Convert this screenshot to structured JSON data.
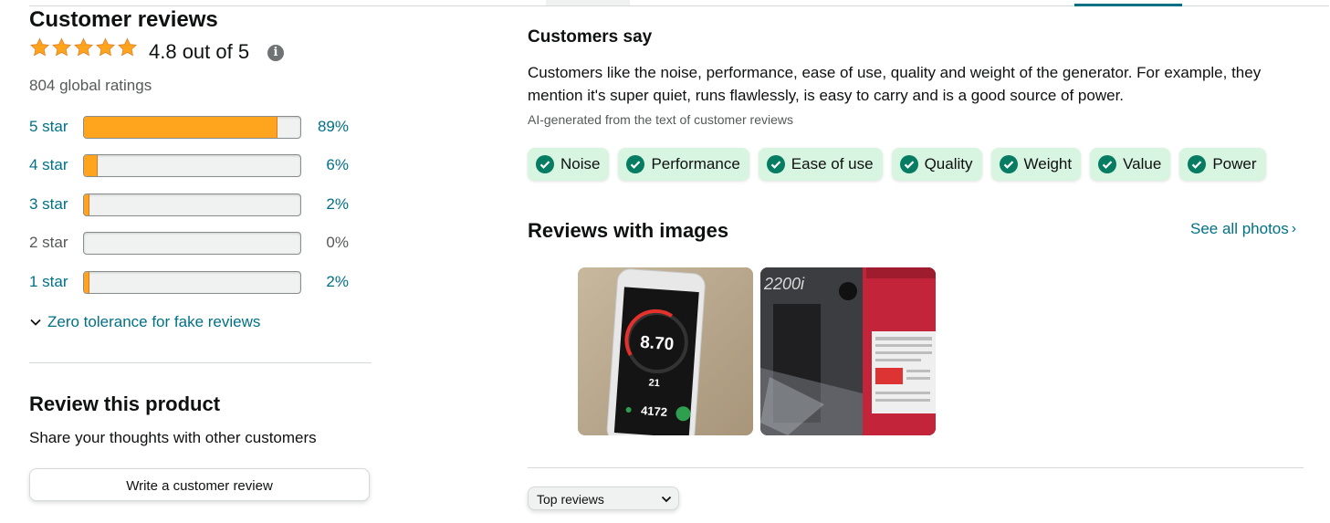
{
  "ratings": {
    "heading": "Customer reviews",
    "stars_shown": 4.8,
    "rating_text": "4.8 out of 5",
    "info_icon": "info-icon",
    "global_ratings": "804 global ratings",
    "histogram": [
      {
        "label": "5 star",
        "percent": 89,
        "percent_text": "89%"
      },
      {
        "label": "4 star",
        "percent": 6,
        "percent_text": "6%"
      },
      {
        "label": "3 star",
        "percent": 2,
        "percent_text": "2%"
      },
      {
        "label": "2 star",
        "percent": 0,
        "percent_text": "0%"
      },
      {
        "label": "1 star",
        "percent": 2,
        "percent_text": "2%"
      }
    ],
    "zero_tolerance_link": "Zero tolerance for fake reviews"
  },
  "review_product": {
    "heading": "Review this product",
    "subtext": "Share your thoughts with other customers",
    "button_label": "Write a customer review"
  },
  "customers_say": {
    "heading": "Customers say",
    "summary": "Customers like the noise, performance, ease of use, quality and weight of the generator. For example, they mention it's super quiet, runs flawlessly, is easy to carry and is a good source of power.",
    "ai_note": "AI-generated from the text of customer reviews",
    "aspects": [
      "Noise",
      "Performance",
      "Ease of use",
      "Quality",
      "Weight",
      "Value",
      "Power"
    ]
  },
  "images": {
    "heading": "Reviews with images",
    "see_all": "See all photos",
    "photo1": {
      "speed": "8.70",
      "oil": "21",
      "hours": "4172"
    },
    "photo2": {
      "model": "2200i"
    }
  },
  "sort": {
    "selected": "Top reviews"
  },
  "colors": {
    "star": "#ffa41c",
    "link": "#007185",
    "chip_bg": "#d7f5e0",
    "check": "#067d62"
  }
}
